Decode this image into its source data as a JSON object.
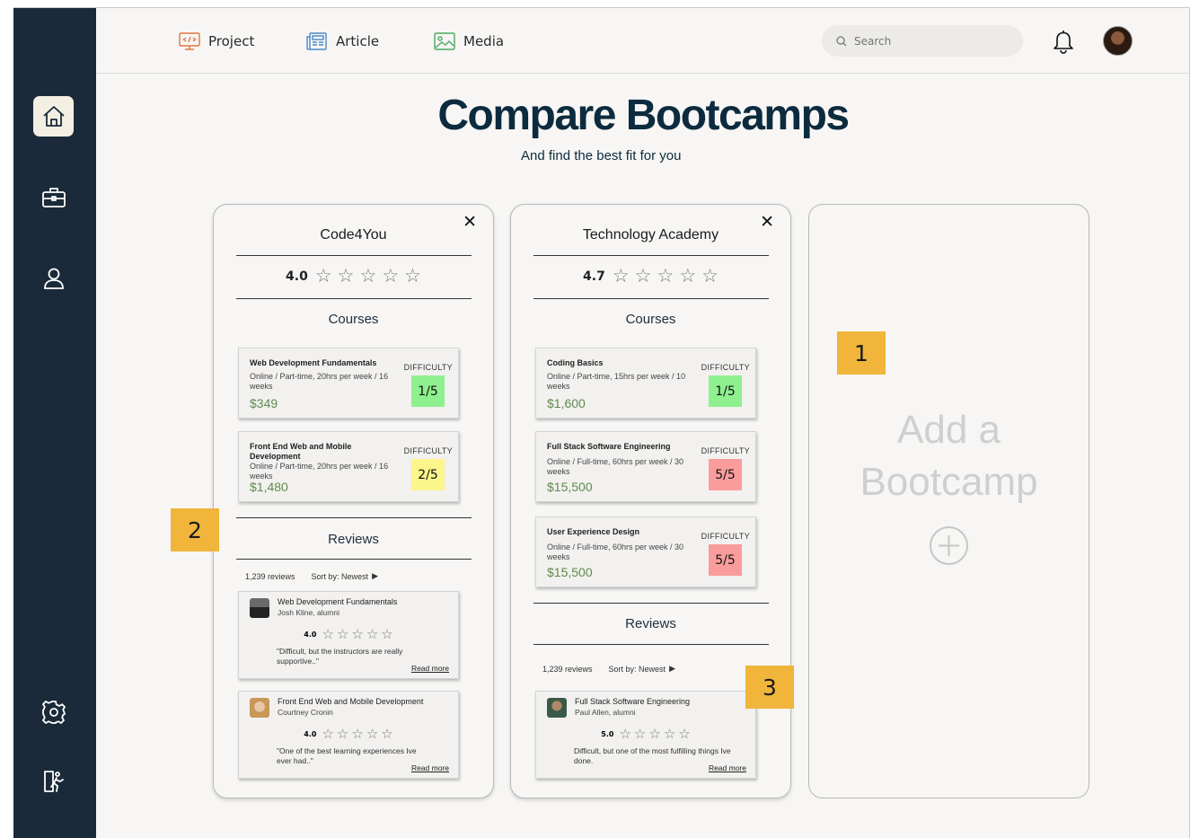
{
  "nav": {
    "project_label": "Project",
    "article_label": "Article",
    "media_label": "Media",
    "search_placeholder": "Search"
  },
  "page": {
    "title": "Compare Bootcamps",
    "subtitle": "And find the best fit for you"
  },
  "colors": {
    "sidebar_bg": "#1a2a3a",
    "title": "#0d2b3e",
    "price": "#5f8a4d",
    "difficulty_easy": "#8ef08e",
    "difficulty_medium": "#fbf58c",
    "difficulty_hard": "#fb9c9c",
    "marker": "#f0b53a"
  },
  "bootcamps": [
    {
      "name": "Code4You",
      "rating": "4.0",
      "courses_heading": "Courses",
      "courses": [
        {
          "name": "Web Development Fundamentals",
          "details": "Online / Part-time, 20hrs per week / 16 weeks",
          "price": "$349",
          "difficulty_label": "DIFFICULTY",
          "difficulty": "1/5"
        },
        {
          "name": "Front End Web and Mobile Development",
          "details": "Online / Part-time, 20hrs per week / 16 weeks",
          "price": "$1,480",
          "difficulty_label": "DIFFICULTY",
          "difficulty": "2/5"
        }
      ],
      "reviews_heading": "Reviews",
      "review_count": "1,239 reviews",
      "sort_label": "Sort by: Newest",
      "reviews": [
        {
          "course": "Web Development Fundamentals",
          "author": "Josh Kline, alumni",
          "rating": "4.0",
          "text": "\"Difficult, but the instructors are really supportive..\"",
          "more": "Read more"
        },
        {
          "course": "Front End Web and Mobile Development",
          "author": "Courtney Cronin",
          "rating": "4.0",
          "text": "\"One of the best learning experiences Ive ever had..\"",
          "more": "Read more"
        }
      ]
    },
    {
      "name": "Technology Academy",
      "rating": "4.7",
      "courses_heading": "Courses",
      "courses": [
        {
          "name": "Coding Basics",
          "details": "Online / Part-time, 15hrs per week / 10 weeks",
          "price": "$1,600",
          "difficulty_label": "DIFFICULTY",
          "difficulty": "1/5"
        },
        {
          "name": "Full Stack Software Engineering",
          "details": "Online / Full-time, 60hrs per week / 30 weeks",
          "price": "$15,500",
          "difficulty_label": "DIFFICULTY",
          "difficulty": "5/5"
        },
        {
          "name": "User Experience Design",
          "details": "Online / Full-time, 60hrs per week / 30 weeks",
          "price": "$15,500",
          "difficulty_label": "DIFFICULTY",
          "difficulty": "5/5"
        }
      ],
      "reviews_heading": "Reviews",
      "review_count": "1,239 reviews",
      "sort_label": "Sort by: Newest",
      "reviews": [
        {
          "course": "Full Stack Software Engineering",
          "author": "Paul Allen, alumni",
          "rating": "5.0",
          "text": "Difficult, but one of the most fulfilling things Ive done.",
          "more": "Read more"
        }
      ]
    }
  ],
  "add_card": {
    "text_line1": "Add a",
    "text_line2": "Bootcamp"
  },
  "markers": [
    "1",
    "2",
    "3"
  ],
  "icons": {
    "sidebar": [
      "home-icon",
      "briefcase-icon",
      "user-icon",
      "gear-icon",
      "exit-icon"
    ],
    "nav": [
      "code-monitor-icon",
      "newspaper-icon",
      "image-icon",
      "search-icon",
      "bell-icon"
    ],
    "star": "☆",
    "close": "✕",
    "sort": "▶"
  }
}
